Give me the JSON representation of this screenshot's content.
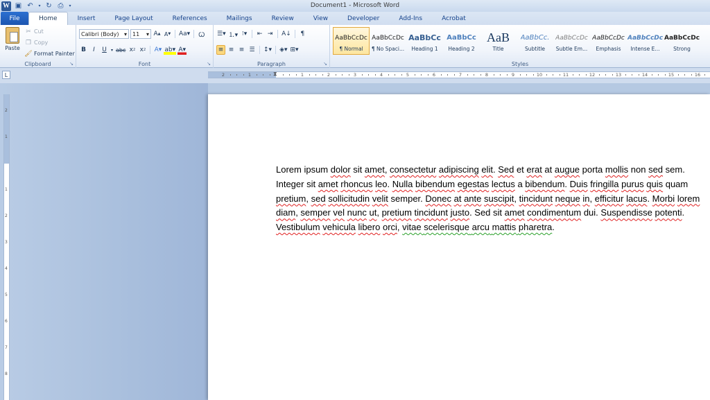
{
  "window": {
    "title": "Document1 - Microsoft Word"
  },
  "tabs": [
    "File",
    "Home",
    "Insert",
    "Page Layout",
    "References",
    "Mailings",
    "Review",
    "View",
    "Developer",
    "Add-Ins",
    "Acrobat"
  ],
  "clipboard": {
    "paste": "Paste",
    "cut": "Cut",
    "copy": "Copy",
    "format_painter": "Format Painter",
    "label": "Clipboard"
  },
  "font": {
    "name": "Calibri (Body)",
    "size": "11",
    "label": "Font"
  },
  "paragraph": {
    "label": "Paragraph"
  },
  "styles": {
    "label": "Styles",
    "items": [
      {
        "sample": "AaBbCcDc",
        "name": "¶ Normal"
      },
      {
        "sample": "AaBbCcDc",
        "name": "¶ No Spaci..."
      },
      {
        "sample": "AaBbCc",
        "name": "Heading 1"
      },
      {
        "sample": "AaBbCc",
        "name": "Heading 2"
      },
      {
        "sample": "AaB",
        "name": "Title"
      },
      {
        "sample": "AaBbCc.",
        "name": "Subtitle"
      },
      {
        "sample": "AaBbCcDc",
        "name": "Subtle Em..."
      },
      {
        "sample": "AaBbCcDc",
        "name": "Emphasis"
      },
      {
        "sample": "AaBbCcDc",
        "name": "Intense E..."
      },
      {
        "sample": "AaBbCcDc",
        "name": "Strong"
      }
    ]
  },
  "ruler": {
    "corner": "L"
  },
  "document": {
    "segments": [
      [
        "Lorem ipsum ",
        ""
      ],
      [
        "dolor",
        "sq"
      ],
      [
        " sit ",
        ""
      ],
      [
        "amet",
        "sq"
      ],
      [
        ", ",
        ""
      ],
      [
        "consectetur",
        "sq"
      ],
      [
        " ",
        ""
      ],
      [
        "adipiscing",
        "sq"
      ],
      [
        " ",
        ""
      ],
      [
        "elit",
        "sq"
      ],
      [
        ". ",
        ""
      ],
      [
        "Sed",
        "sq"
      ],
      [
        " et ",
        ""
      ],
      [
        "erat",
        "sq"
      ],
      [
        " at ",
        ""
      ],
      [
        "augue",
        "sq"
      ],
      [
        " porta ",
        ""
      ],
      [
        "mollis",
        "sq"
      ],
      [
        " non ",
        ""
      ],
      [
        "sed",
        "sq"
      ],
      [
        " sem. Integer sit ",
        ""
      ],
      [
        "amet",
        "sq"
      ],
      [
        " ",
        ""
      ],
      [
        "rhoncus",
        "sq"
      ],
      [
        " ",
        ""
      ],
      [
        "leo",
        "sq"
      ],
      [
        ". ",
        ""
      ],
      [
        "Nulla",
        "sq"
      ],
      [
        " ",
        ""
      ],
      [
        "bibendum",
        "sq"
      ],
      [
        " ",
        ""
      ],
      [
        "egestas",
        "sq"
      ],
      [
        " ",
        ""
      ],
      [
        "lectus",
        "sq"
      ],
      [
        " a ",
        ""
      ],
      [
        "bibendum",
        "sq"
      ],
      [
        ". ",
        ""
      ],
      [
        "Duis",
        "sq"
      ],
      [
        " ",
        ""
      ],
      [
        "fringilla",
        "sq"
      ],
      [
        " ",
        ""
      ],
      [
        "purus",
        "sq"
      ],
      [
        " ",
        ""
      ],
      [
        "quis",
        "sq"
      ],
      [
        " quam ",
        ""
      ],
      [
        "pretium",
        "sq"
      ],
      [
        ", ",
        ""
      ],
      [
        "sed",
        "sq"
      ],
      [
        " ",
        ""
      ],
      [
        "sollicitudin",
        "sq"
      ],
      [
        " ",
        ""
      ],
      [
        "velit",
        "sq"
      ],
      [
        " semper. ",
        ""
      ],
      [
        "Donec",
        "sq"
      ],
      [
        " ",
        ""
      ],
      [
        "at",
        "sq"
      ],
      [
        " ",
        ""
      ],
      [
        "ante",
        "sq"
      ],
      [
        " ",
        ""
      ],
      [
        "suscipit",
        "sq"
      ],
      [
        ", ",
        ""
      ],
      [
        "tincidunt",
        "sq"
      ],
      [
        " ",
        ""
      ],
      [
        "neque",
        "sq"
      ],
      [
        " ",
        ""
      ],
      [
        "in",
        "sq"
      ],
      [
        ", ",
        ""
      ],
      [
        "efficitur",
        "sq"
      ],
      [
        " ",
        ""
      ],
      [
        "lacus",
        "sq"
      ],
      [
        ". ",
        ""
      ],
      [
        "Morbi",
        "sq"
      ],
      [
        " ",
        ""
      ],
      [
        "lorem",
        "sq"
      ],
      [
        " ",
        ""
      ],
      [
        "diam",
        "sq"
      ],
      [
        ", ",
        ""
      ],
      [
        "semper",
        "sq"
      ],
      [
        " ",
        ""
      ],
      [
        "vel",
        "sq"
      ],
      [
        " ",
        ""
      ],
      [
        "nunc",
        "sq"
      ],
      [
        " ",
        ""
      ],
      [
        "ut",
        "sq"
      ],
      [
        ", ",
        ""
      ],
      [
        "pretium",
        "sq"
      ],
      [
        " ",
        ""
      ],
      [
        "tincidunt",
        "sq"
      ],
      [
        " ",
        ""
      ],
      [
        "justo",
        "sq"
      ],
      [
        ". Sed sit ",
        ""
      ],
      [
        "amet",
        "sq"
      ],
      [
        " ",
        ""
      ],
      [
        "condimentum",
        "sq"
      ],
      [
        " dui. ",
        ""
      ],
      [
        "Suspendisse",
        "sq"
      ],
      [
        " ",
        ""
      ],
      [
        "potenti",
        "sq"
      ],
      [
        ". ",
        ""
      ],
      [
        "Vestibulum",
        "sq"
      ],
      [
        " ",
        ""
      ],
      [
        "vehicula",
        "sq"
      ],
      [
        " ",
        ""
      ],
      [
        "libero",
        "sq"
      ],
      [
        " ",
        ""
      ],
      [
        "orci",
        "sq"
      ],
      [
        ", ",
        ""
      ],
      [
        "vitae",
        "gq"
      ],
      [
        " ",
        "gq"
      ],
      [
        "scelerisque",
        "gq"
      ],
      [
        " ",
        "gq"
      ],
      [
        "arcu",
        "gq"
      ],
      [
        " ",
        "gq"
      ],
      [
        "mattis",
        "gq"
      ],
      [
        " ",
        "gq"
      ],
      [
        "pharetra",
        "gq"
      ],
      [
        ".",
        ""
      ]
    ]
  },
  "icons": {
    "save": "save-icon",
    "undo": "undo-icon",
    "redo": "redo-icon",
    "print": "print-preview-icon",
    "customize": "customize-qat-icon"
  },
  "colors": {
    "accent": "#2b5797",
    "highlight": "#fbd87f",
    "spell": "#e02020",
    "grammar": "#2aa02a"
  }
}
